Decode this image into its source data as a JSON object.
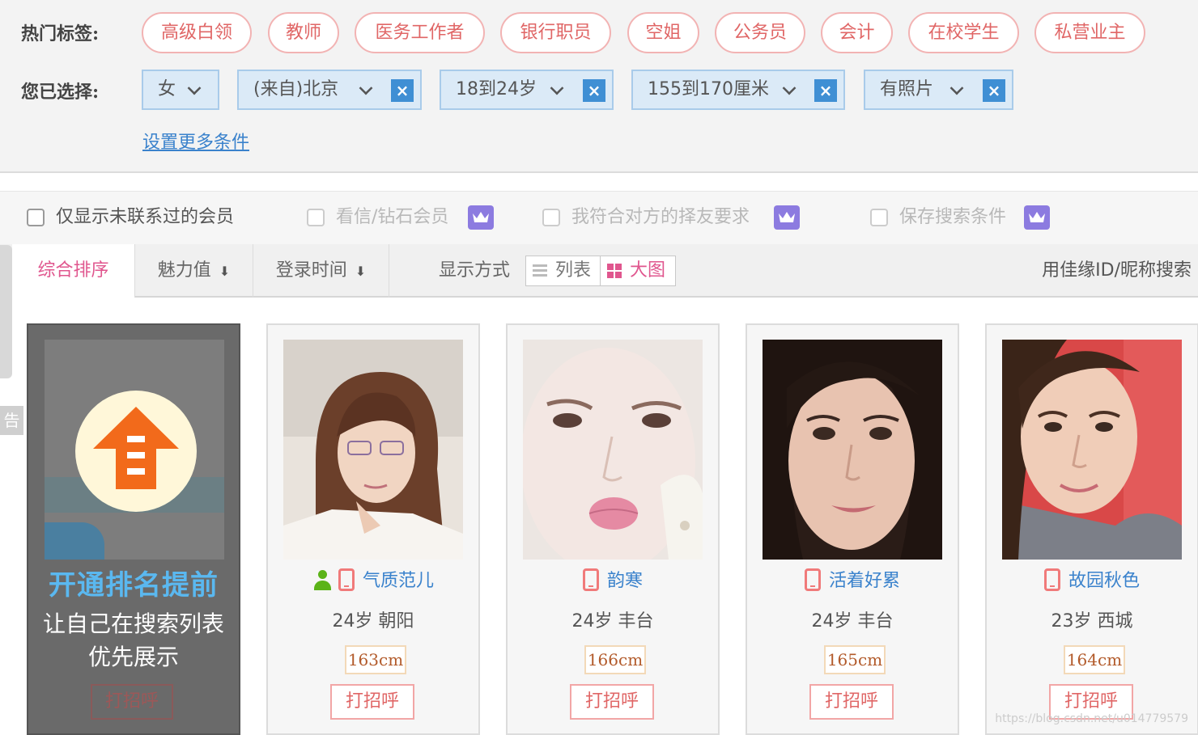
{
  "filters": {
    "hot_label": "热门标签:",
    "hot_tags": [
      "高级白领",
      "教师",
      "医务工作者",
      "银行职员",
      "空姐",
      "公务员",
      "会计",
      "在校学生",
      "私营业主"
    ],
    "selected_label": "您已选择:",
    "selected": [
      "女",
      "(来自)北京",
      "18到24岁",
      "155到170厘米",
      "有照片"
    ],
    "remove_glyph": "×",
    "more_link": "设置更多条件"
  },
  "options": {
    "only_uncontacted": "仅显示未联系过的会员",
    "letter_diamond": "看信/钻石会员",
    "match_requirements": "我符合对方的择友要求",
    "save_search": "保存搜索条件"
  },
  "sort": {
    "composite": "综合排序",
    "charm": "魅力值",
    "login_time": "登录时间",
    "down_arrow": "⬇",
    "display_mode": "显示方式",
    "list": "列表",
    "big": "大图",
    "id_search": "用佳缘ID/昵称搜索"
  },
  "side": {
    "tab_char": "告"
  },
  "promo": {
    "title": "开通排名提前",
    "line1": "让自己在搜索列表",
    "line2": "优先展示",
    "greet": "打招呼"
  },
  "members": [
    {
      "name": "气质范儿",
      "age_city": "24岁  朝阳",
      "height": "163cm",
      "greet": "打招呼"
    },
    {
      "name": "韵寒",
      "age_city": "24岁  丰台",
      "height": "166cm",
      "greet": "打招呼"
    },
    {
      "name": "活着好累",
      "age_city": "24岁  丰台",
      "height": "165cm",
      "greet": "打招呼"
    },
    {
      "name": "故园秋色",
      "age_city": "23岁  西城",
      "height": "164cm",
      "greet": "打招呼"
    }
  ],
  "watermark": "https://blog.csdn.net/u014779579"
}
